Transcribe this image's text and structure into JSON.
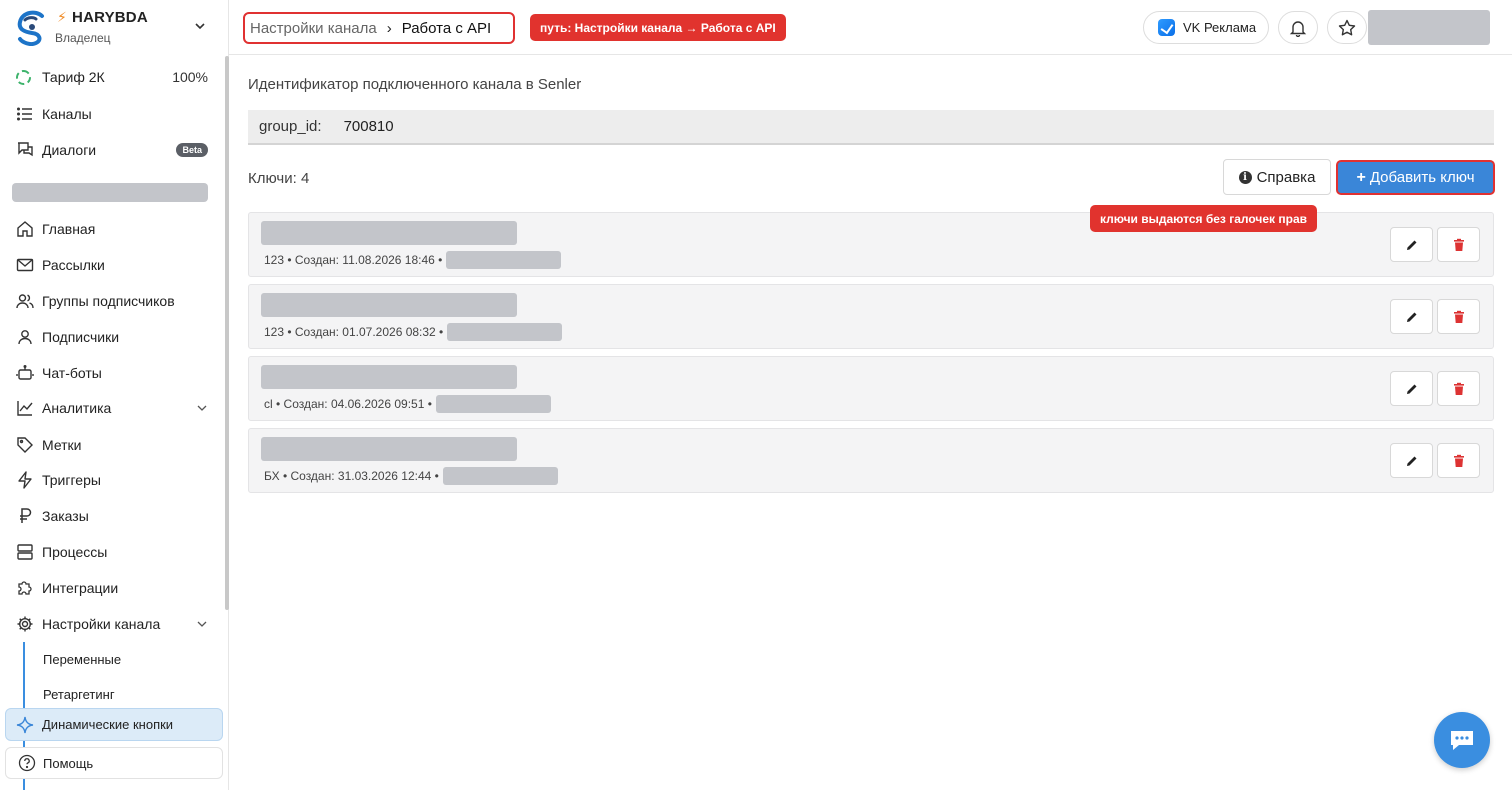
{
  "brand": {
    "name": "HARYBDA",
    "role": "Владелец"
  },
  "tariff": {
    "label": "Тариф 2К",
    "percent": "100%"
  },
  "nav_top": [
    {
      "label": "Каналы",
      "icon": "list-icon"
    },
    {
      "label": "Диалоги",
      "icon": "chat-icon",
      "badge": "Beta"
    }
  ],
  "nav_main": [
    {
      "label": "Главная",
      "icon": "home-icon"
    },
    {
      "label": "Рассылки",
      "icon": "mail-icon"
    },
    {
      "label": "Группы подписчиков",
      "icon": "users-icon"
    },
    {
      "label": "Подписчики",
      "icon": "user-icon"
    },
    {
      "label": "Чат-боты",
      "icon": "bot-icon"
    },
    {
      "label": "Аналитика",
      "icon": "chart-icon"
    },
    {
      "label": "Метки",
      "icon": "tag-icon"
    },
    {
      "label": "Триггеры",
      "icon": "bolt-icon"
    },
    {
      "label": "Заказы",
      "icon": "ruble-icon"
    },
    {
      "label": "Процессы",
      "icon": "server-icon"
    },
    {
      "label": "Интеграции",
      "icon": "puzzle-icon"
    },
    {
      "label": "Настройки канала",
      "icon": "gear-icon"
    }
  ],
  "nav_sub": {
    "variables": "Переменные",
    "retargeting": "Ретаргетинг",
    "dynamic_buttons": "Динамические кнопки"
  },
  "help": "Помощь",
  "header": {
    "crumb_parent": "Настройки канала",
    "crumb_sep": "›",
    "crumb_current": "Работа с API",
    "path_note": "путь: Настройки канала → Работа с API",
    "vk_ads": "VK Реклама"
  },
  "main": {
    "ident_title": "Идентификатор подключенного канала в Senler",
    "group_id_label": "group_id:",
    "group_id_value": "700810",
    "keys_count": "Ключи: 4",
    "help_button": "Справка",
    "add_button": "Добавить ключ",
    "keys_note": "ключи выдаются без галочек прав"
  },
  "keys": [
    {
      "meta": "123 • Создан: 11.08.2026 18:46 •"
    },
    {
      "meta": "123 • Создан: 01.07.2026 08:32 •"
    },
    {
      "meta": "cl • Создан: 04.06.2026 09:51 •"
    },
    {
      "meta": "БХ • Создан: 31.03.2026 12:44 •"
    }
  ],
  "colors": {
    "accent": "#3a86d8",
    "alert": "#e1332e",
    "active_bg": "#dcebf8"
  }
}
